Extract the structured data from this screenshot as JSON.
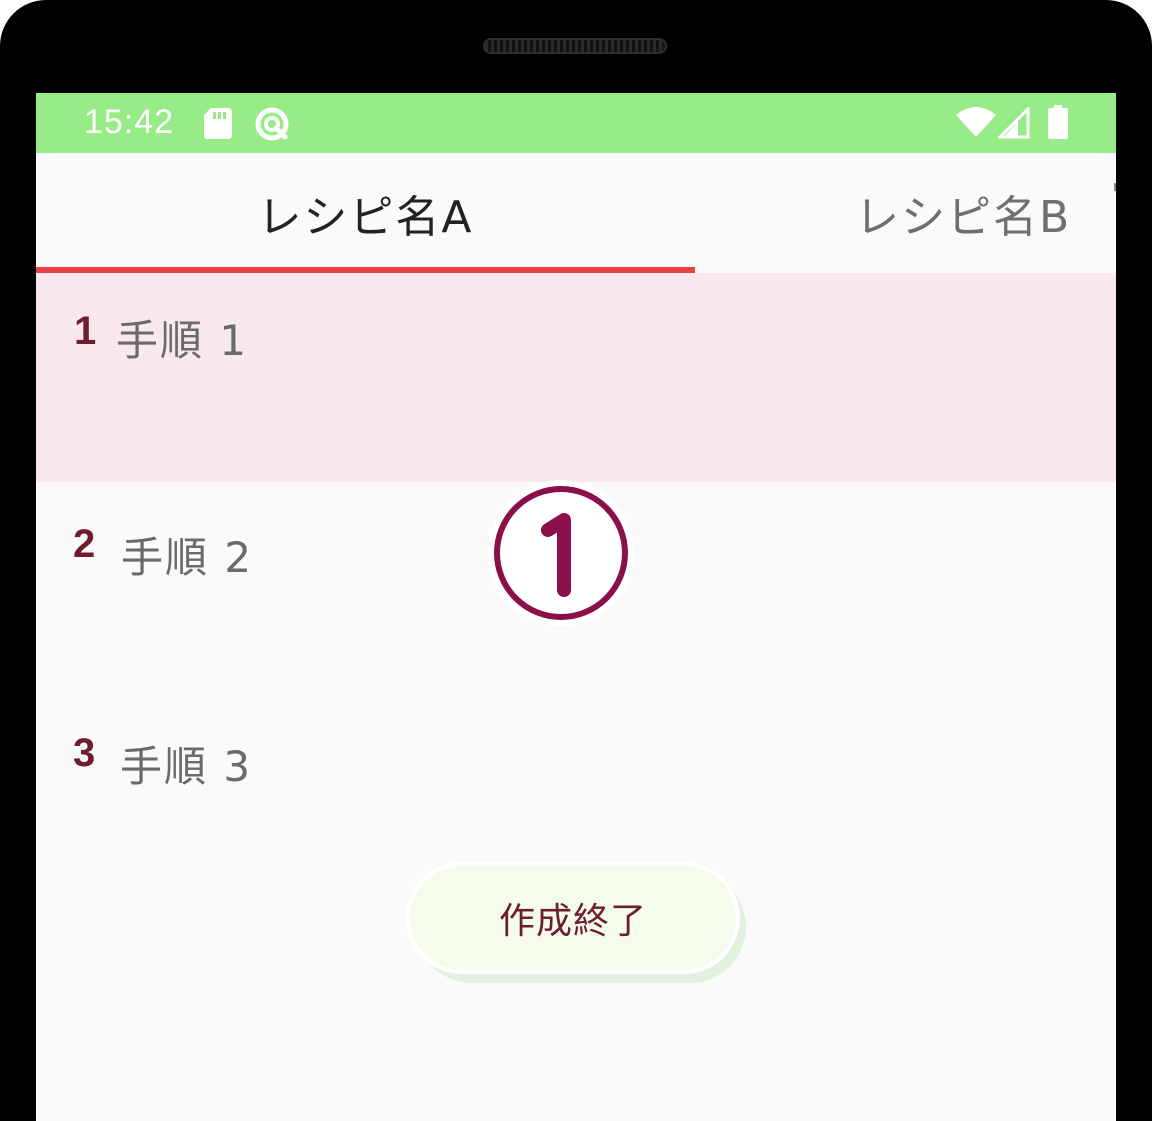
{
  "status_bar": {
    "time": "15:42",
    "background_color": "#98ec87",
    "left_icons": [
      "sd-card-icon",
      "sync-icon"
    ],
    "right_icons": [
      "wifi-icon",
      "cell-signal-icon",
      "battery-icon"
    ]
  },
  "tabs": [
    {
      "label": "レシピ名A",
      "selected": true
    },
    {
      "label": "レシピ名B",
      "selected": false
    }
  ],
  "tab_indicator_color": "#e94343",
  "steps": [
    {
      "number": "1",
      "label": "手順 1",
      "selected": true
    },
    {
      "number": "2",
      "label": "手順 2",
      "selected": false
    },
    {
      "number": "3",
      "label": "手順 3",
      "selected": false
    }
  ],
  "annotation_marker": "①",
  "finish_button": {
    "label": "作成終了"
  },
  "colors": {
    "selected_row": "#f9e9ee",
    "step_number": "#6e1d2f",
    "marker": "#8b0f4a",
    "button_bg": "#f4fdec"
  }
}
